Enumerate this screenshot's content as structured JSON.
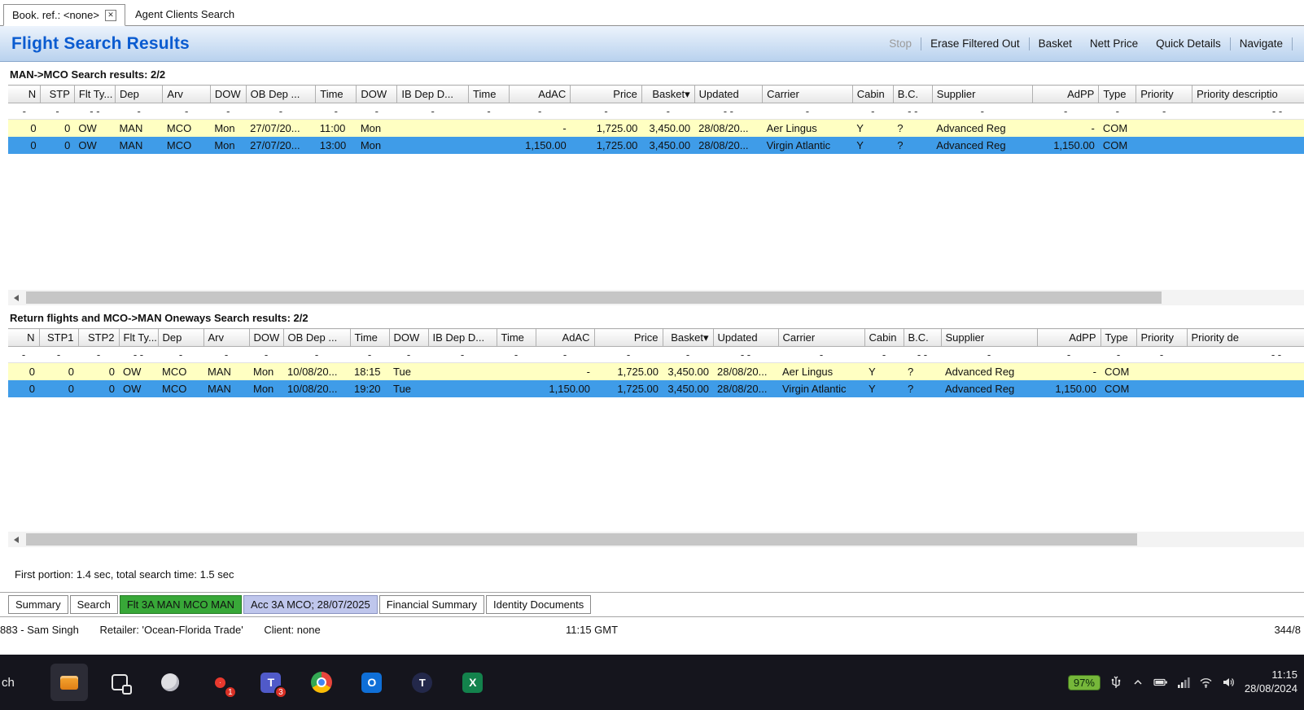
{
  "window": {
    "doc_tabs": [
      {
        "label": "Book. ref.: <none>",
        "close_glyph": "✕"
      },
      {
        "label": "Agent Clients Search"
      }
    ]
  },
  "toolbar": {
    "title": "Flight Search Results",
    "actions": [
      {
        "label": "Stop"
      },
      {
        "label": "Erase Filtered Out"
      },
      {
        "label": "Basket"
      },
      {
        "label": "Nett Price"
      },
      {
        "label": "Quick Details"
      },
      {
        "label": "Navigate"
      }
    ]
  },
  "outbound_results": {
    "section_title": "MAN->MCO Search results: 2/2",
    "columns": [
      "N",
      "STP",
      "Flt Ty...",
      "Dep",
      "Arv",
      "DOW",
      "OB Dep ...",
      "Time",
      "DOW",
      "IB Dep D...",
      "Time",
      "AdAC",
      "Price",
      "Basket▾",
      "Updated",
      "Carrier",
      "Cabin",
      "B.C.",
      "Supplier",
      "AdPP",
      "Type",
      "Priority",
      "Priority descriptio"
    ],
    "filter_row": [
      "-",
      "-",
      "- -",
      "-",
      "-",
      "-",
      "-",
      "-",
      "-",
      "-",
      "-",
      "-",
      "-",
      "-",
      "- -",
      "-",
      "-",
      "- -",
      "-",
      "-",
      "-",
      "-",
      "- -"
    ],
    "rows": [
      {
        "state": "highlight",
        "cells": [
          "0",
          "0",
          "OW",
          "MAN",
          "MCO",
          "Mon",
          "27/07/20...",
          "11:00",
          "Mon",
          "",
          "",
          "-",
          "1,725.00",
          "3,450.00",
          "28/08/20...",
          "Aer Lingus",
          "Y",
          "?",
          "Advanced Reg",
          "-",
          "COM",
          "",
          ""
        ]
      },
      {
        "state": "selected",
        "cells": [
          "0",
          "0",
          "OW",
          "MAN",
          "MCO",
          "Mon",
          "27/07/20...",
          "13:00",
          "Mon",
          "",
          "",
          "1,150.00",
          "1,725.00",
          "3,450.00",
          "28/08/20...",
          "Virgin Atlantic",
          "Y",
          "?",
          "Advanced Reg",
          "1,150.00",
          "COM",
          "",
          ""
        ]
      }
    ]
  },
  "return_results": {
    "section_title": "Return flights and MCO->MAN Oneways Search results: 2/2",
    "columns": [
      "N",
      "STP1",
      "STP2",
      "Flt Ty...",
      "Dep",
      "Arv",
      "DOW",
      "OB Dep ...",
      "Time",
      "DOW",
      "IB Dep D...",
      "Time",
      "AdAC",
      "Price",
      "Basket▾",
      "Updated",
      "Carrier",
      "Cabin",
      "B.C.",
      "Supplier",
      "AdPP",
      "Type",
      "Priority",
      "Priority de"
    ],
    "filter_row": [
      "-",
      "-",
      "-",
      "- -",
      "-",
      "-",
      "-",
      "-",
      "-",
      "-",
      "-",
      "-",
      "-",
      "-",
      "-",
      "- -",
      "-",
      "-",
      "- -",
      "-",
      "-",
      "-",
      "-",
      "- -"
    ],
    "rows": [
      {
        "state": "highlight",
        "cells": [
          "0",
          "0",
          "0",
          "OW",
          "MCO",
          "MAN",
          "Mon",
          "10/08/20...",
          "18:15",
          "Tue",
          "",
          "",
          "-",
          "1,725.00",
          "3,450.00",
          "28/08/20...",
          "Aer Lingus",
          "Y",
          "?",
          "Advanced Reg",
          "-",
          "COM",
          "",
          ""
        ]
      },
      {
        "state": "selected",
        "cells": [
          "0",
          "0",
          "0",
          "OW",
          "MCO",
          "MAN",
          "Mon",
          "10/08/20...",
          "19:20",
          "Tue",
          "",
          "",
          "1,150.00",
          "1,725.00",
          "3,450.00",
          "28/08/20...",
          "Virgin Atlantic",
          "Y",
          "?",
          "Advanced Reg",
          "1,150.00",
          "COM",
          "",
          ""
        ]
      }
    ]
  },
  "status": {
    "search_time": "First portion: 1.4 sec, total search time: 1.5 sec"
  },
  "bottom_tabs": [
    {
      "label": "Summary"
    },
    {
      "label": "Search"
    },
    {
      "label": "Flt 3A MAN MCO MAN"
    },
    {
      "label": "Acc 3A MCO; 28/07/2025"
    },
    {
      "label": "Financial Summary"
    },
    {
      "label": "Identity Documents"
    }
  ],
  "statusbar": {
    "agent": "883 - Sam Singh",
    "retailer": "Retailer: 'Ocean-Florida Trade'",
    "client": "Client: none",
    "time": "11:15 GMT",
    "counter": "344/8"
  },
  "taskbar": {
    "search_fragment": "ch",
    "icons": [
      {
        "name": "pinned-app"
      },
      {
        "name": "task-view"
      },
      {
        "name": "snip"
      },
      {
        "name": "browser",
        "badge": "1"
      },
      {
        "name": "teams",
        "glyph": "T",
        "badge": "3"
      },
      {
        "name": "chrome"
      },
      {
        "name": "outlook",
        "glyph": "O"
      },
      {
        "name": "t-app",
        "glyph": "T"
      },
      {
        "name": "excel",
        "glyph": "X"
      }
    ],
    "tray": {
      "battery_percent": "97%",
      "time": "11:15",
      "date": "28/08/2024"
    }
  },
  "colors": {
    "title_blue": "#0a5bd0",
    "row_highlight": "#ffffc2",
    "row_selected": "#3f9ce8",
    "tab_green": "#38a838",
    "tab_lavender": "#bfc6ec",
    "battery_green": "#76b73a"
  }
}
